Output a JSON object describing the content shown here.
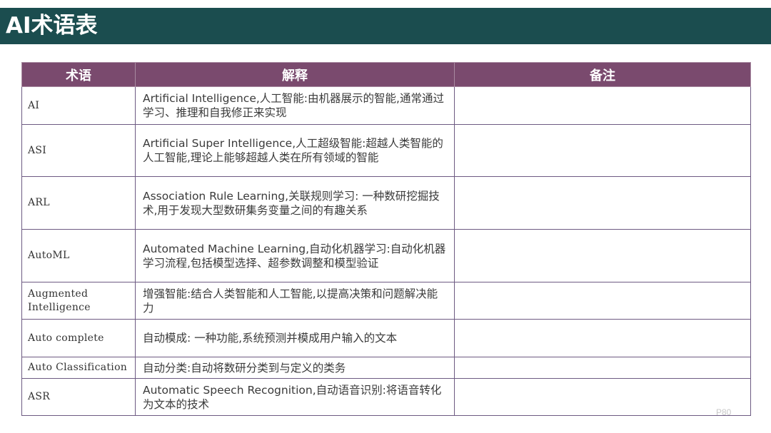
{
  "title": "AI术语表",
  "headers": {
    "term": "术语",
    "explanation": "解释",
    "note": "备注"
  },
  "rows": [
    {
      "term": "AI",
      "explanation": "Artificial Intelligence,人工智能:由机器展示的智能,通常通过学习、推理和自我修正来实现",
      "note": ""
    },
    {
      "term": "ASI",
      "explanation": "Artificial Super Intelligence,人工超级智能:超越人类智能的人工智能,理论上能够超越人类在所有领域的智能",
      "note": ""
    },
    {
      "term": "ARL",
      "explanation": "Association Rule Learning,关联规则学习: 一种数研挖掘技术,用于发现大型数研集务变量之间的有趣关系",
      "note": ""
    },
    {
      "term": "AutoML",
      "explanation": "Automated Machine Learning,自动化机器学习:自动化机器学习流程,包括模型选择、超参数调整和模型验证",
      "note": ""
    },
    {
      "term": "Augmented Intelligence",
      "explanation": "增强智能:结合人类智能和人工智能,以提高决策和问题解决能力",
      "note": ""
    },
    {
      "term": "Auto complete",
      "explanation": "自动模成: 一种功能,系统预测并模成用户输入的文本",
      "note": ""
    },
    {
      "term": "Auto Classification",
      "explanation": "自动分类:自动将数研分类到与定义的类务",
      "note": ""
    },
    {
      "term": "ASR",
      "explanation": "Automatic Speech Recognition,自动语音识别:将语音转化为文本的技术",
      "note": ""
    }
  ],
  "page_number": "P80"
}
